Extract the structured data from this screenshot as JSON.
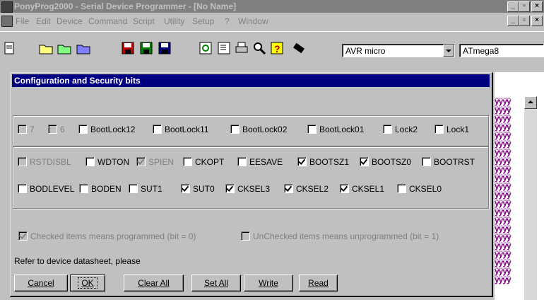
{
  "app": {
    "title": "PonyProg2000 - Serial Device Programmer - [No Name]",
    "menu": [
      "File",
      "Edit",
      "Device",
      "Command",
      "Script",
      "Utility",
      "Setup",
      "?",
      "Window"
    ],
    "device_family": "AVR micro",
    "device_model": "ATmega8",
    "hex_fill": "ÿÿÿÿ"
  },
  "dialog": {
    "title": "Configuration and Security bits",
    "lock_bits": [
      {
        "label": "7",
        "checked": false,
        "disabled": true
      },
      {
        "label": "6",
        "checked": false,
        "disabled": true
      },
      {
        "label": "BootLock12",
        "checked": false,
        "disabled": false
      },
      {
        "label": "BootLock11",
        "checked": false,
        "disabled": false
      },
      {
        "label": "BootLock02",
        "checked": false,
        "disabled": false
      },
      {
        "label": "BootLock01",
        "checked": false,
        "disabled": false
      },
      {
        "label": "Lock2",
        "checked": false,
        "disabled": false
      },
      {
        "label": "Lock1",
        "checked": false,
        "disabled": false
      }
    ],
    "fuse_row1": [
      {
        "label": "RSTDISBL",
        "checked": false,
        "disabled": true
      },
      {
        "label": "WDTON",
        "checked": false,
        "disabled": false
      },
      {
        "label": "SPIEN",
        "checked": true,
        "disabled": true
      },
      {
        "label": "CKOPT",
        "checked": false,
        "disabled": false
      },
      {
        "label": "EESAVE",
        "checked": false,
        "disabled": false
      },
      {
        "label": "BOOTSZ1",
        "checked": true,
        "disabled": false
      },
      {
        "label": "BOOTSZ0",
        "checked": true,
        "disabled": false
      },
      {
        "label": "BOOTRST",
        "checked": false,
        "disabled": false
      }
    ],
    "fuse_row2": [
      {
        "label": "BODLEVEL",
        "checked": false,
        "disabled": false
      },
      {
        "label": "BODEN",
        "checked": false,
        "disabled": false
      },
      {
        "label": "SUT1",
        "checked": false,
        "disabled": false
      },
      {
        "label": "SUT0",
        "checked": true,
        "disabled": false
      },
      {
        "label": "CKSEL3",
        "checked": true,
        "disabled": false
      },
      {
        "label": "CKSEL2",
        "checked": true,
        "disabled": false
      },
      {
        "label": "CKSEL1",
        "checked": true,
        "disabled": false
      },
      {
        "label": "CKSEL0",
        "checked": false,
        "disabled": false
      }
    ],
    "legend_checked": "Checked items means programmed (bit = 0)",
    "legend_unchecked": "UnChecked items means unprogrammed (bit = 1)",
    "note": "Refer to device datasheet, please",
    "buttons": {
      "cancel": "Cancel",
      "ok": "OK",
      "clear_all": "Clear All",
      "set_all": "Set All",
      "write": "Write",
      "read": "Read"
    }
  },
  "colors": {
    "dialog_title_bg": "#000080",
    "app_title_bg": "#808080",
    "hex_text": "#800080"
  }
}
